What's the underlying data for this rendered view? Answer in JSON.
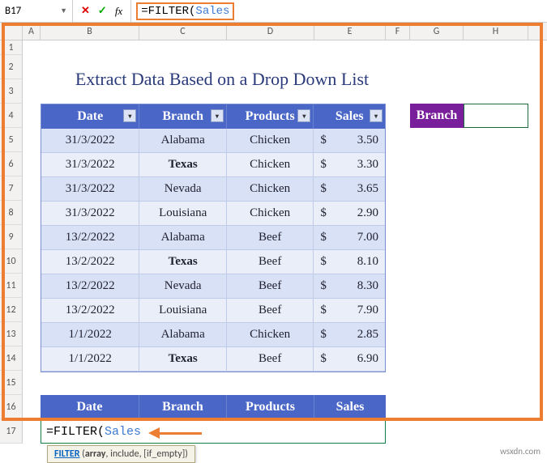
{
  "name_box": "B17",
  "formula": {
    "prefix": "=FILTER(",
    "ref": "Sales"
  },
  "columns": [
    "A",
    "B",
    "C",
    "D",
    "E",
    "F",
    "G",
    "H"
  ],
  "rows": [
    "1",
    "2",
    "3",
    "4",
    "5",
    "6",
    "7",
    "8",
    "9",
    "10",
    "11",
    "12",
    "13",
    "14",
    "15",
    "16",
    "17"
  ],
  "title": "Extract Data Based on a Drop Down List",
  "headers": {
    "date": "Date",
    "branch": "Branch",
    "products": "Products",
    "sales": "Sales"
  },
  "table": [
    {
      "date": "31/3/2022",
      "branch": "Alabama",
      "product": "Chicken",
      "cur": "$",
      "amt": "3.50",
      "bold": false
    },
    {
      "date": "31/3/2022",
      "branch": "Texas",
      "product": "Chicken",
      "cur": "$",
      "amt": "3.30",
      "bold": true
    },
    {
      "date": "31/3/2022",
      "branch": "Nevada",
      "product": "Chicken",
      "cur": "$",
      "amt": "3.65",
      "bold": false
    },
    {
      "date": "31/3/2022",
      "branch": "Louisiana",
      "product": "Chicken",
      "cur": "$",
      "amt": "2.90",
      "bold": false
    },
    {
      "date": "13/2/2022",
      "branch": "Alabama",
      "product": "Beef",
      "cur": "$",
      "amt": "7.00",
      "bold": false
    },
    {
      "date": "13/2/2022",
      "branch": "Texas",
      "product": "Beef",
      "cur": "$",
      "amt": "8.10",
      "bold": true
    },
    {
      "date": "13/2/2022",
      "branch": "Nevada",
      "product": "Beef",
      "cur": "$",
      "amt": "8.30",
      "bold": false
    },
    {
      "date": "13/2/2022",
      "branch": "Louisiana",
      "product": "Beef",
      "cur": "$",
      "amt": "7.90",
      "bold": false
    },
    {
      "date": "1/1/2022",
      "branch": "Alabama",
      "product": "Chicken",
      "cur": "$",
      "amt": "2.85",
      "bold": false
    },
    {
      "date": "1/1/2022",
      "branch": "Texas",
      "product": "Beef",
      "cur": "$",
      "amt": "6.90",
      "bold": true
    }
  ],
  "branch_label": "Branch",
  "branch_value": "",
  "tooltip": {
    "fname": "FILTER",
    "args": "(array, include, [if_empty])",
    "current": "array"
  },
  "watermark": "wsxdn.com"
}
